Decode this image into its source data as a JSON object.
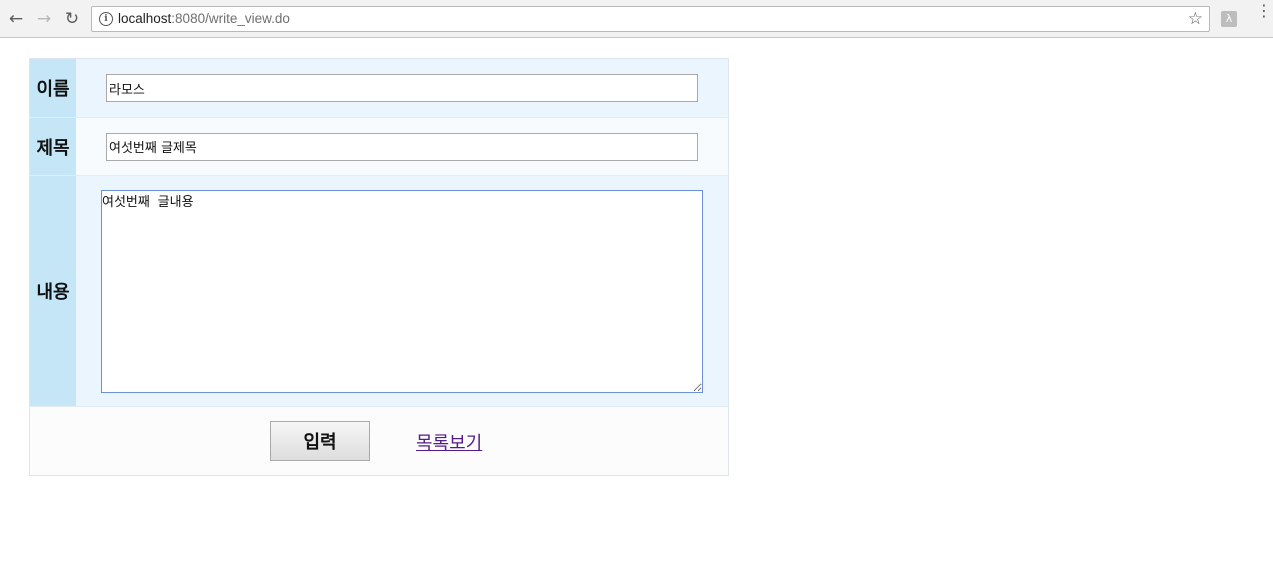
{
  "browser": {
    "url_host": "localhost",
    "url_path": ":8080/write_view.do",
    "icons": {
      "back": "back-arrow-icon",
      "forward": "forward-arrow-icon",
      "reload": "reload-icon",
      "info": "info-icon",
      "bookmark": "star-icon",
      "extension": "pdf-extension-icon",
      "menu": "kebab-menu-icon"
    }
  },
  "form": {
    "name_label": "이름",
    "name_value": "라모스",
    "title_label": "제목",
    "title_value": "여섯번째 글제목",
    "content_label": "내용",
    "content_value": "여섯번째 글내용",
    "submit_label": "입력",
    "list_link_label": "목록보기"
  },
  "colors": {
    "label_bg": "#c5e6f7",
    "field_bg": "#eaf5fd",
    "link": "#551a8b",
    "textarea_focus_border": "#6b8fd9"
  }
}
